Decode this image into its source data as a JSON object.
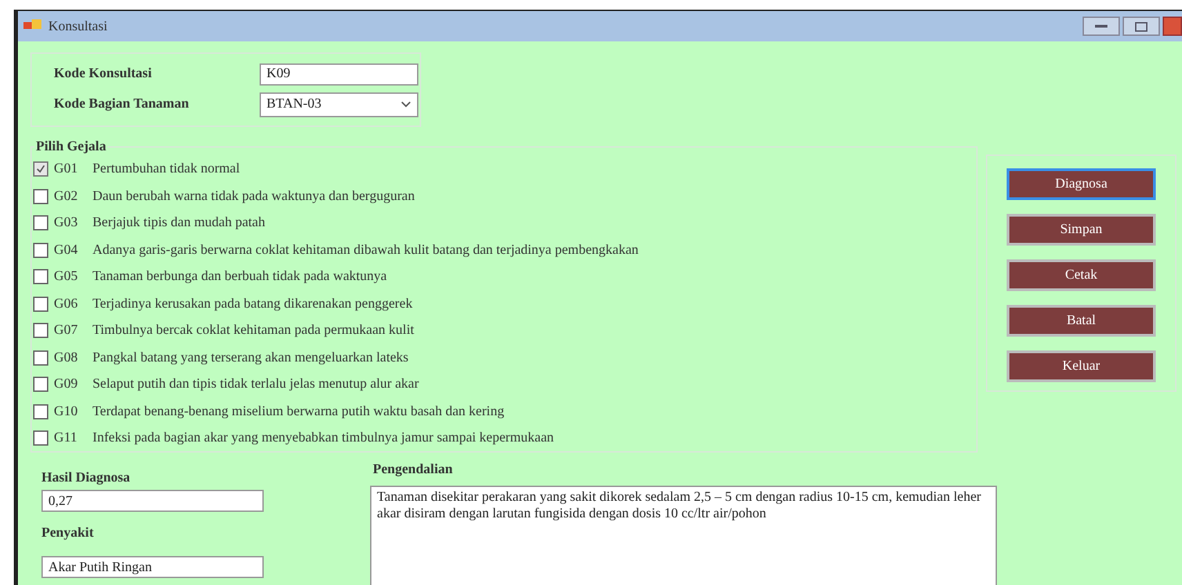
{
  "window": {
    "title": "Konsultasi"
  },
  "header": {
    "kode_konsultasi": {
      "label": "Kode Konsultasi",
      "value": "K09"
    },
    "kode_bagian": {
      "label": "Kode Bagian Tanaman",
      "value": "BTAN-03"
    }
  },
  "gejala": {
    "title": "Pilih Gejala",
    "items": [
      {
        "code": "G01",
        "text": "Pertumbuhan tidak normal",
        "checked": true
      },
      {
        "code": "G02",
        "text": "Daun berubah warna tidak pada waktunya dan berguguran",
        "checked": false
      },
      {
        "code": "G03",
        "text": "Berjajuk tipis dan mudah patah",
        "checked": false
      },
      {
        "code": "G04",
        "text": "Adanya garis-garis berwarna coklat kehitaman dibawah kulit batang dan terjadinya pembengkakan",
        "checked": false
      },
      {
        "code": "G05",
        "text": "Tanaman berbunga dan berbuah tidak pada waktunya",
        "checked": false
      },
      {
        "code": "G06",
        "text": "Terjadinya kerusakan pada batang dikarenakan penggerek",
        "checked": false
      },
      {
        "code": "G07",
        "text": "Timbulnya bercak coklat kehitaman pada permukaan kulit",
        "checked": false
      },
      {
        "code": "G08",
        "text": "Pangkal batang yang terserang akan mengeluarkan lateks",
        "checked": false
      },
      {
        "code": "G09",
        "text": "Selaput putih dan tipis tidak terlalu jelas menutup alur akar",
        "checked": false
      },
      {
        "code": "G10",
        "text": "Terdapat benang-benang miselium berwarna putih waktu basah dan kering",
        "checked": false
      },
      {
        "code": "G11",
        "text": "Infeksi pada bagian akar yang menyebabkan timbulnya jamur sampai kepermukaan",
        "checked": false
      }
    ]
  },
  "buttons": [
    {
      "label": "Diagnosa",
      "focused": true
    },
    {
      "label": "Simpan",
      "focused": false
    },
    {
      "label": "Cetak",
      "focused": false
    },
    {
      "label": "Batal",
      "focused": false
    },
    {
      "label": "Keluar",
      "focused": false
    }
  ],
  "hasil": {
    "label": "Hasil Diagnosa",
    "value": "0,27"
  },
  "penyakit": {
    "label": "Penyakit",
    "value": "Akar Putih Ringan"
  },
  "pengendalian": {
    "label": "Pengendalian",
    "value": "Tanaman disekitar perakaran yang sakit dikorek sedalam 2,5 – 5 cm dengan radius 10-15 cm, kemudian leher akar disiram dengan larutan fungisida dengan dosis 10 cc/ltr air/pohon"
  }
}
